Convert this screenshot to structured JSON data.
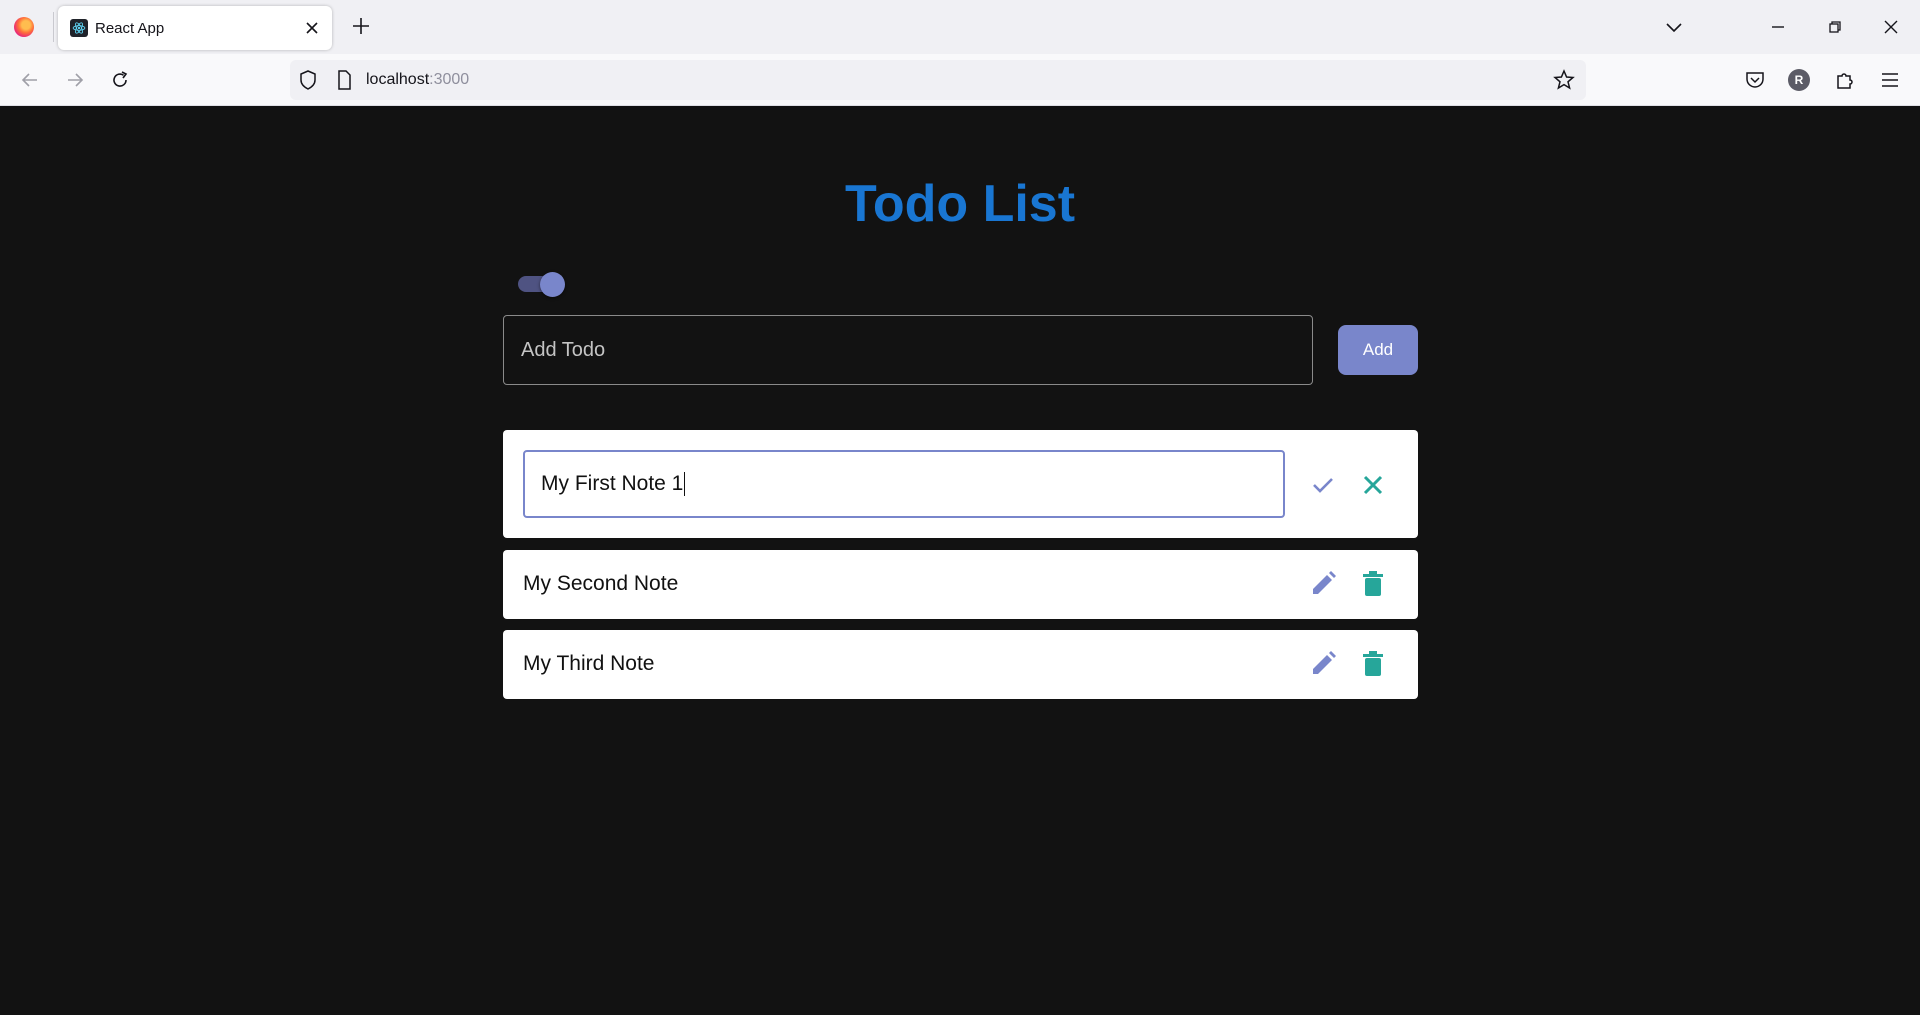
{
  "browser": {
    "tab_title": "React App",
    "url_host": "localhost",
    "url_port": ":3000",
    "profile_initial": "R"
  },
  "app": {
    "title": "Todo List",
    "theme_toggle_on": true,
    "add_placeholder": "Add Todo",
    "add_button_label": "Add",
    "colors": {
      "background": "#121212",
      "title": "#1976d2",
      "primary": "#7986cb",
      "secondary": "#26a69a"
    }
  },
  "todos": [
    {
      "text": "My First Note 1",
      "editing": true
    },
    {
      "text": "My Second Note",
      "editing": false
    },
    {
      "text": "My Third Note",
      "editing": false
    }
  ]
}
